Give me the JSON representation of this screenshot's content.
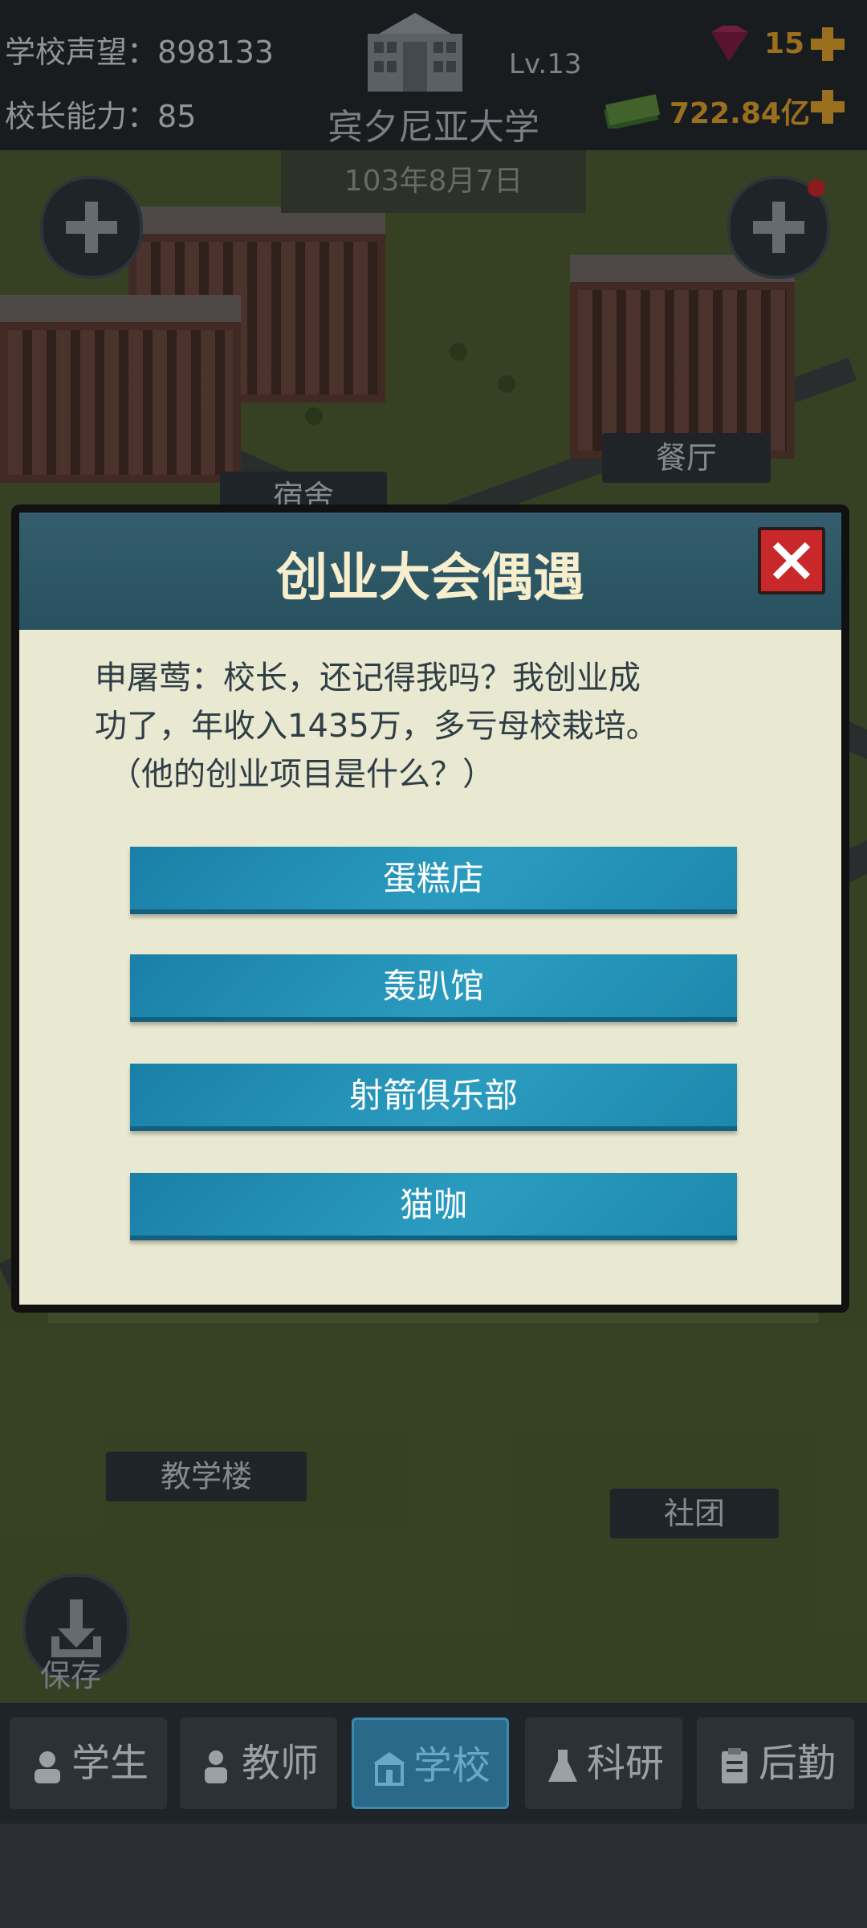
{
  "header": {
    "reputation_label": "学校声望：",
    "reputation_value": "898133",
    "ability_label": "校长能力：",
    "ability_value": "85",
    "level": "Lv.13",
    "school_name": "宾夕尼亚大学",
    "gems": "15",
    "money": "722.84亿"
  },
  "map": {
    "date": "103年8月7日",
    "labels": {
      "dorm": "宿舍",
      "restaurant": "餐厅",
      "teaching": "教学楼",
      "club": "社团"
    },
    "save_label": "保存"
  },
  "dialog": {
    "title": "创业大会偶遇",
    "lines": [
      "申屠莺：校长，还记得我吗？我创业成",
      "功了，年收入1435万，多亏母校栽培。",
      "（他的创业项目是什么？）"
    ],
    "options": [
      "蛋糕店",
      "轰趴馆",
      "射箭俱乐部",
      "猫咖"
    ]
  },
  "nav": {
    "tabs": [
      {
        "label": "学生",
        "icon": "student-icon"
      },
      {
        "label": "教师",
        "icon": "teacher-icon"
      },
      {
        "label": "学校",
        "icon": "school-icon"
      },
      {
        "label": "科研",
        "icon": "flask-icon"
      },
      {
        "label": "后勤",
        "icon": "clipboard-icon"
      }
    ],
    "active_index": 2
  },
  "colors": {
    "accent_gold": "#d69a2a",
    "button_blue": "#2a9bbf",
    "close_red": "#c8282a",
    "dialog_body": "#e9e8d0",
    "active_tab": "#2a6a88"
  }
}
